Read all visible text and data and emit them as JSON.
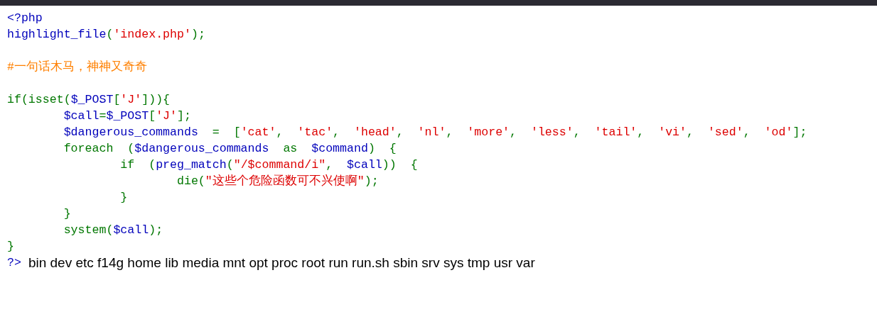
{
  "lines": [
    {
      "kind": "code",
      "tokens": [
        {
          "kind": "default",
          "text": "<?php"
        }
      ]
    },
    {
      "kind": "code",
      "tokens": [
        {
          "kind": "default",
          "text": "highlight_file"
        },
        {
          "kind": "keyword",
          "text": "("
        },
        {
          "kind": "string",
          "text": "'index.php'"
        },
        {
          "kind": "keyword",
          "text": ");"
        }
      ]
    },
    {
      "kind": "blank"
    },
    {
      "kind": "code",
      "tokens": [
        {
          "kind": "comment",
          "text": "#一句话木马，神神又奇奇"
        }
      ]
    },
    {
      "kind": "blank"
    },
    {
      "kind": "code",
      "tokens": [
        {
          "kind": "keyword",
          "text": "if(isset("
        },
        {
          "kind": "default",
          "text": "$_POST"
        },
        {
          "kind": "keyword",
          "text": "["
        },
        {
          "kind": "string",
          "text": "'J'"
        },
        {
          "kind": "keyword",
          "text": "])){"
        }
      ]
    },
    {
      "kind": "code",
      "tokens": [
        {
          "kind": "default",
          "text": "        $call"
        },
        {
          "kind": "keyword",
          "text": "="
        },
        {
          "kind": "default",
          "text": "$_POST"
        },
        {
          "kind": "keyword",
          "text": "["
        },
        {
          "kind": "string",
          "text": "'J'"
        },
        {
          "kind": "keyword",
          "text": "];"
        }
      ]
    },
    {
      "kind": "code",
      "tokens": [
        {
          "kind": "default",
          "text": "        $dangerous_commands  "
        },
        {
          "kind": "keyword",
          "text": "=  ["
        },
        {
          "kind": "string",
          "text": "'cat'"
        },
        {
          "kind": "keyword",
          "text": ",  "
        },
        {
          "kind": "string",
          "text": "'tac'"
        },
        {
          "kind": "keyword",
          "text": ",  "
        },
        {
          "kind": "string",
          "text": "'head'"
        },
        {
          "kind": "keyword",
          "text": ",  "
        },
        {
          "kind": "string",
          "text": "'nl'"
        },
        {
          "kind": "keyword",
          "text": ",  "
        },
        {
          "kind": "string",
          "text": "'more'"
        },
        {
          "kind": "keyword",
          "text": ",  "
        },
        {
          "kind": "string",
          "text": "'less'"
        },
        {
          "kind": "keyword",
          "text": ",  "
        },
        {
          "kind": "string",
          "text": "'tail'"
        },
        {
          "kind": "keyword",
          "text": ",  "
        },
        {
          "kind": "string",
          "text": "'vi'"
        },
        {
          "kind": "keyword",
          "text": ",  "
        },
        {
          "kind": "string",
          "text": "'sed'"
        },
        {
          "kind": "keyword",
          "text": ",  "
        },
        {
          "kind": "string",
          "text": "'od'"
        },
        {
          "kind": "keyword",
          "text": "];"
        }
      ]
    },
    {
      "kind": "code",
      "tokens": [
        {
          "kind": "keyword",
          "text": "        foreach  ("
        },
        {
          "kind": "default",
          "text": "$dangerous_commands  "
        },
        {
          "kind": "keyword",
          "text": "as  "
        },
        {
          "kind": "default",
          "text": "$command"
        },
        {
          "kind": "keyword",
          "text": ")  {"
        }
      ]
    },
    {
      "kind": "code",
      "tokens": [
        {
          "kind": "keyword",
          "text": "                if  ("
        },
        {
          "kind": "default",
          "text": "preg_match"
        },
        {
          "kind": "keyword",
          "text": "("
        },
        {
          "kind": "string",
          "text": "\"/$command/i\""
        },
        {
          "kind": "keyword",
          "text": ",  "
        },
        {
          "kind": "default",
          "text": "$call"
        },
        {
          "kind": "keyword",
          "text": "))  {"
        }
      ]
    },
    {
      "kind": "code",
      "tokens": [
        {
          "kind": "keyword",
          "text": "                        die("
        },
        {
          "kind": "string",
          "text": "\"这些个危险函数可不兴使啊\""
        },
        {
          "kind": "keyword",
          "text": ");"
        }
      ]
    },
    {
      "kind": "code",
      "tokens": [
        {
          "kind": "keyword",
          "text": "                }"
        }
      ]
    },
    {
      "kind": "code",
      "tokens": [
        {
          "kind": "keyword",
          "text": "        }"
        }
      ]
    },
    {
      "kind": "code",
      "tokens": [
        {
          "kind": "keyword",
          "text": "        system("
        },
        {
          "kind": "default",
          "text": "$call"
        },
        {
          "kind": "keyword",
          "text": ");"
        }
      ]
    },
    {
      "kind": "code",
      "tokens": [
        {
          "kind": "keyword",
          "text": "}"
        }
      ]
    },
    {
      "kind": "code",
      "tokens": [
        {
          "kind": "default",
          "text": "?>"
        }
      ],
      "output": "bin dev etc f14g home lib media mnt opt proc root run run.sh sbin srv sys tmp usr var"
    }
  ]
}
